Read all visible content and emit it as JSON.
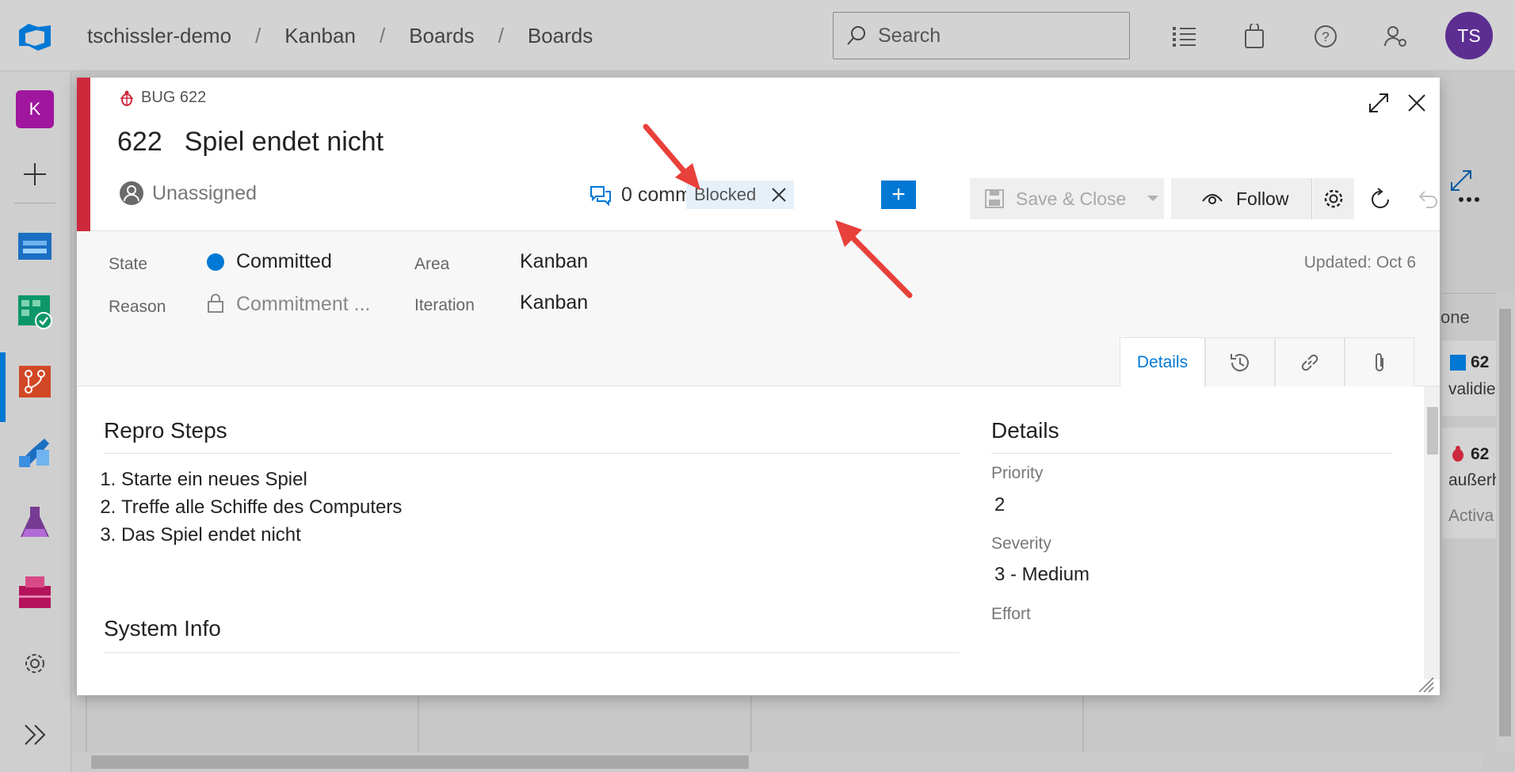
{
  "breadcrumb": [
    "tschissler-demo",
    "Kanban",
    "Boards",
    "Boards"
  ],
  "search": {
    "placeholder": "Search"
  },
  "user": {
    "initials": "TS"
  },
  "rail": {
    "project_letter": "K"
  },
  "background": {
    "col_header": "one",
    "card1_id": "62",
    "card1_text": "validie",
    "card2_id": "62",
    "card2_text": "außerh",
    "card2_state": "Activa"
  },
  "workitem": {
    "type_label": "BUG 622",
    "id": "622",
    "title": "Spiel endet nicht",
    "assigned": "Unassigned",
    "comments": "0 comments",
    "tag": "Blocked",
    "add_tag": "+",
    "save_close": "Save & Close",
    "follow": "Follow"
  },
  "fields": {
    "state_label": "State",
    "state_value": "Committed",
    "reason_label": "Reason",
    "reason_value": "Commitment ...",
    "area_label": "Area",
    "area_value": "Kanban",
    "iteration_label": "Iteration",
    "iteration_value": "Kanban",
    "updated": "Updated: Oct 6"
  },
  "tabs": {
    "details": "Details"
  },
  "repro": {
    "title": "Repro Steps",
    "steps": [
      "Starte ein neues Spiel",
      "Treffe alle Schiffe des Computers",
      "Das Spiel endet nicht"
    ]
  },
  "system_info": {
    "title": "System Info"
  },
  "details": {
    "title": "Details",
    "priority_label": "Priority",
    "priority_value": "2",
    "severity_label": "Severity",
    "severity_value": "3 - Medium",
    "effort_label": "Effort"
  },
  "colors": {
    "accent": "#0078d4",
    "bug_red": "#cc293d",
    "state_dot": "#0078d4",
    "annotation_arrow": "#e8403a"
  }
}
